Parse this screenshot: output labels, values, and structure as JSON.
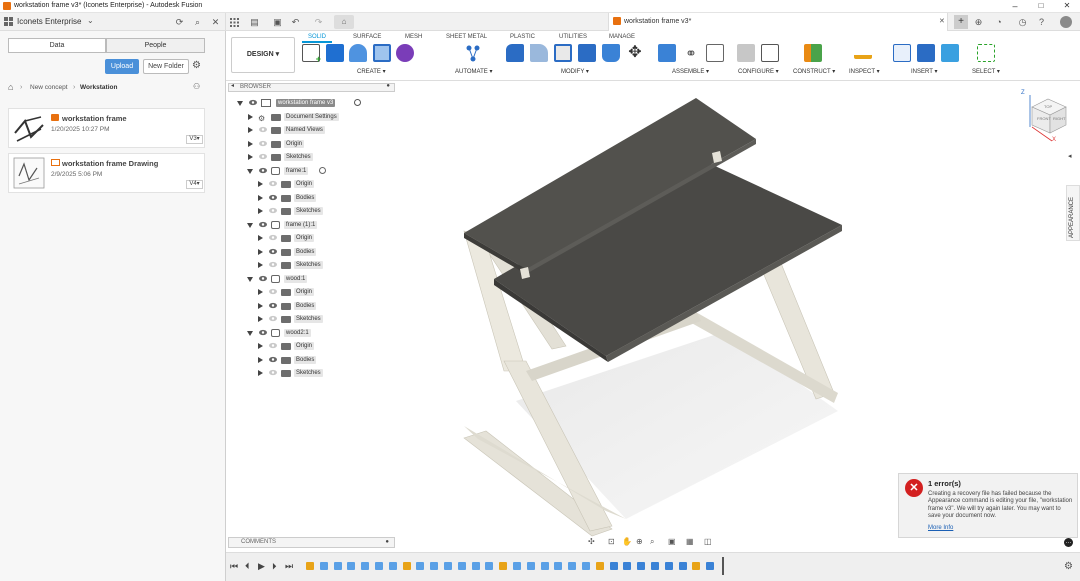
{
  "window": {
    "title": "workstation frame v3* (Iconets Enterprise) - Autodesk Fusion",
    "minimize": "–",
    "maximize": "□",
    "close": "✕"
  },
  "hub": {
    "name": "Iconets Enterprise"
  },
  "document_tab": {
    "label": "workstation frame v3*"
  },
  "data_panel": {
    "tabs": [
      "Data",
      "People"
    ],
    "upload_label": "Upload",
    "new_folder_label": "New Folder",
    "breadcrumb": [
      "New concept",
      "Workstation"
    ],
    "files": [
      {
        "name": "workstation frame",
        "date": "1/20/2025 10:27 PM",
        "version": "V3"
      },
      {
        "name": "workstation frame Drawing",
        "date": "2/9/2025 5:06 PM",
        "version": "V4"
      }
    ]
  },
  "toolbar": {
    "workspace": "DESIGN",
    "tabs": [
      "SOLID",
      "SURFACE",
      "MESH",
      "SHEET METAL",
      "PLASTIC",
      "UTILITIES",
      "MANAGE"
    ],
    "active_tab": "SOLID",
    "groups": [
      "CREATE",
      "AUTOMATE",
      "MODIFY",
      "ASSEMBLE",
      "CONFIGURE",
      "CONSTRUCT",
      "INSPECT",
      "INSERT",
      "SELECT"
    ]
  },
  "browser": {
    "header": "BROWSER",
    "root": "workstation frame v3",
    "items": [
      {
        "label": "Document Settings",
        "level": 1
      },
      {
        "label": "Named Views",
        "level": 1
      },
      {
        "label": "Origin",
        "level": 1
      },
      {
        "label": "Sketches",
        "level": 1
      },
      {
        "label": "frame:1",
        "level": 1,
        "expanded": true
      },
      {
        "label": "Origin",
        "level": 2
      },
      {
        "label": "Bodies",
        "level": 2
      },
      {
        "label": "Sketches",
        "level": 2
      },
      {
        "label": "frame (1):1",
        "level": 1,
        "expanded": true
      },
      {
        "label": "Origin",
        "level": 2
      },
      {
        "label": "Bodies",
        "level": 2
      },
      {
        "label": "Sketches",
        "level": 2
      },
      {
        "label": "wood:1",
        "level": 1,
        "expanded": true
      },
      {
        "label": "Origin",
        "level": 2
      },
      {
        "label": "Bodies",
        "level": 2
      },
      {
        "label": "Sketches",
        "level": 2
      },
      {
        "label": "wood2:1",
        "level": 1,
        "expanded": true
      },
      {
        "label": "Origin",
        "level": 2
      },
      {
        "label": "Bodies",
        "level": 2
      },
      {
        "label": "Sketches",
        "level": 2
      }
    ]
  },
  "comments": {
    "label": "COMMENTS"
  },
  "right_panel": {
    "label": "APPEARANCE"
  },
  "viewcube": {
    "front": "FRONT",
    "right": "RIGHT",
    "top": "TOP",
    "axis_z": "Z",
    "axis_x": "X"
  },
  "error": {
    "title": "1 error(s)",
    "body": "Creating a recovery file has failed because the Appearance command is editing your file, \"workstation frame v3\". We will try again later. You may want to save your document now.",
    "link": "More Info"
  },
  "colors": {
    "accent": "#0696d7",
    "frame_metal": "#e5e2d8",
    "wood_top": "#4c4b48",
    "error_red": "#d32020",
    "upload_blue": "#4a90d9"
  }
}
